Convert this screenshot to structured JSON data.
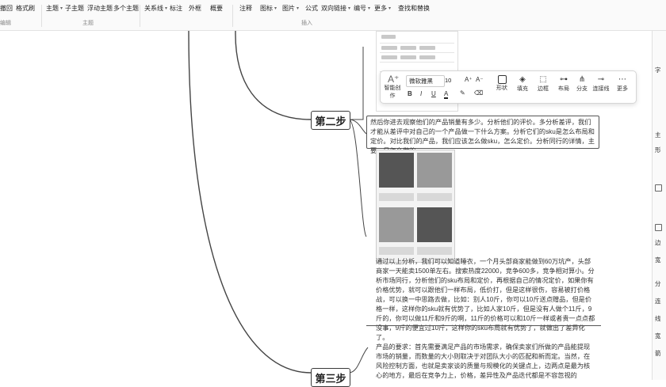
{
  "ribbon": {
    "items": [
      "撤回",
      "格式刷",
      "主题",
      "子主题",
      "浮动主题",
      "多个主题",
      "关系线",
      "标注",
      "外框",
      "概要",
      "注释",
      "图标",
      "图片",
      "公式",
      "双向链接",
      "编号",
      "更多",
      "查找和替换"
    ],
    "groups": [
      "编辑",
      "主题",
      "插入"
    ]
  },
  "mindmap": {
    "step2_label": "第二步",
    "step3_label": "第三步",
    "step2_note": "然后你进去观察他们的产品销量有多少。分析他们的评价。多分析差评，我们才能从差评中对自己的一个产品做一下什么方案。分析它们的sku是怎么布局和定价。对比我们的产品，我们应该怎么做sku，怎么定价。分析同行的详情，主要，是怎么做的。",
    "analysis_note": "通过以上分析，我们可以知道睡衣，一个月头部商家能做到60万坑产，头部商家一天能卖1500单左右。搜索热度22000，竞争600多，竞争相对算小。分析市场同行，分析他们的sku布局和定价，再根据自己的情况定价，如果你有价格优势，就可以跟他们一样布局，低价打，但是这样很伤，容易被打价格战，可以换一中思路去做，比如：别人10斤，你可以10斤送点赠品，但是价格一样，这样你的sku就有优势了，比如人家10斤，但是没有人做个11斤，9斤的，你可以做11斤和9斤的啊，11斤的价格可以和10斤一样或者贵一点点都没事，9斤的便宜过10斤，这样你的sku布局就有优势了，就做出了差异化了。",
    "requirements_note": "产品的要求：首先需要满足产品的市场需求，确保卖家们所做的产品能提现市场的销量，而数量的大小则取决于对团队大小的匹配和新而定。当然，在风险控制方面，也就是卖家谈的质量与规模化的关键点上，边两点是最为核心的地方，最后在竞争力上，价格，差异性及产品迭代都是不容忽视的"
  },
  "toolbar": {
    "ai_label": "智能创作",
    "font_name": "微软雅黑",
    "font_size": "10",
    "grow_font": "A⁺",
    "shrink_font": "A⁻",
    "bold": "B",
    "italic": "I",
    "underline": "U",
    "font_color": "A",
    "shape_label": "形状",
    "fill_label": "填充",
    "border_label": "边框",
    "layout_label": "布局",
    "branch_label": "分支",
    "connector_label": "连接线",
    "more_label": "更多"
  },
  "right_panel": {
    "labels": [
      "字",
      "主",
      "形",
      "边",
      "宽",
      "分",
      "连",
      "线",
      "宽",
      "箭"
    ]
  }
}
